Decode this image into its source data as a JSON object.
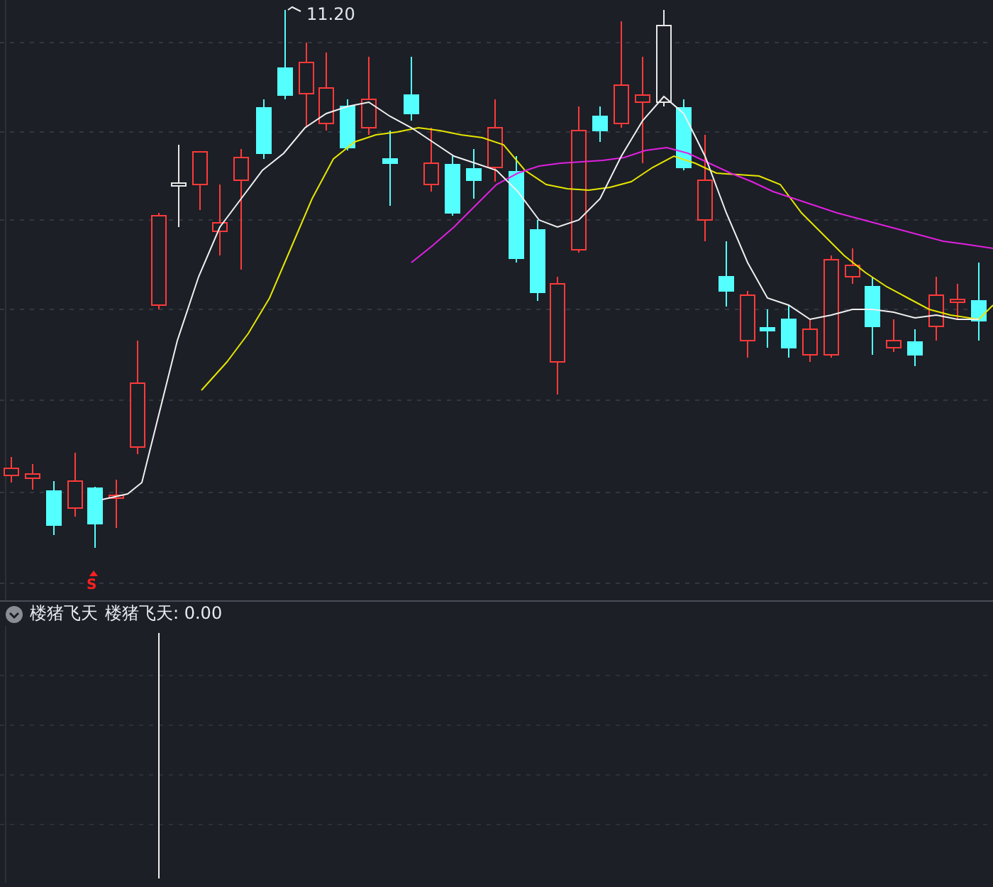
{
  "main_chart": {
    "high_marker": "11.20",
    "signal_mark": "S"
  },
  "indicator": {
    "expanded": true,
    "name": "楼猪飞天",
    "reading": "楼猪飞天: 0.00"
  }
}
